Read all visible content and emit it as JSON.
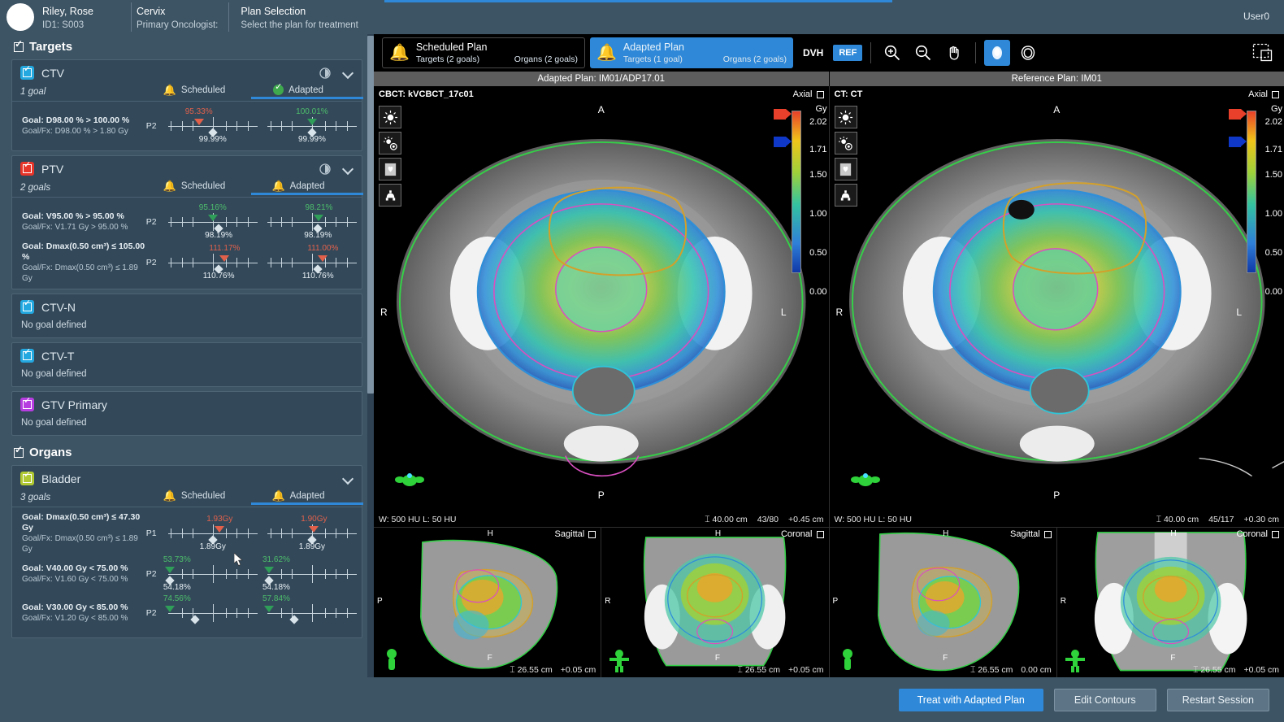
{
  "header": {
    "patient_name": "Riley, Rose",
    "patient_id": "ID1: S003",
    "site": "Cervix",
    "oncologist_label": "Primary Oncologist:",
    "task_title": "Plan Selection",
    "task_sub": "Select the plan for treatment",
    "user": "User0"
  },
  "targets": {
    "group_label": "Targets",
    "rois": [
      {
        "name": "CTV",
        "color": "#23a8e0",
        "goal_count": "1 goal",
        "scheduled_label": "Scheduled",
        "adapted_label": "Adapted",
        "scheduled_status": "bell",
        "adapted_status": "check",
        "goals": [
          {
            "goal": "Goal: D98.00 % > 100.00 %",
            "goal_fx": "Goal/Fx: D98.00 % > 1.80 Gy",
            "priority": "P2",
            "scheduled": {
              "value": "95.33%",
              "state": "bad",
              "pos": 36,
              "diamond": "99.99%",
              "diamond_pos": 50
            },
            "adapted": {
              "value": "100.01%",
              "state": "ok",
              "pos": 50,
              "diamond": "99.99%",
              "diamond_pos": 50
            }
          }
        ]
      },
      {
        "name": "PTV",
        "color": "#e8352a",
        "goal_count": "2 goals",
        "scheduled_label": "Scheduled",
        "adapted_label": "Adapted",
        "scheduled_status": "bell",
        "adapted_status": "bell",
        "goals": [
          {
            "goal": "Goal: V95.00 % > 95.00 %",
            "goal_fx": "Goal/Fx: V1.71 Gy > 95.00 %",
            "priority": "P2",
            "scheduled": {
              "value": "95.16%",
              "state": "ok",
              "pos": 50,
              "diamond": "98.19%",
              "diamond_pos": 56
            },
            "adapted": {
              "value": "98.21%",
              "state": "ok",
              "pos": 57,
              "diamond": "98.19%",
              "diamond_pos": 56
            }
          },
          {
            "goal": "Goal: Dmax(0.50 cm³) ≤ 105.00 %",
            "goal_fx": "Goal/Fx: Dmax(0.50 cm³) ≤ 1.89 Gy",
            "priority": "P2",
            "scheduled": {
              "value": "111.17%",
              "state": "bad",
              "pos": 62,
              "diamond": "110.76%",
              "diamond_pos": 56
            },
            "adapted": {
              "value": "111.00%",
              "state": "bad",
              "pos": 61,
              "diamond": "110.76%",
              "diamond_pos": 56
            }
          }
        ]
      },
      {
        "name": "CTV-N",
        "color": "#23a8e0",
        "no_goal": "No goal defined"
      },
      {
        "name": "CTV-T",
        "color": "#23a8e0",
        "no_goal": "No goal defined"
      },
      {
        "name": "GTV Primary",
        "color": "#b63ee0",
        "no_goal": "No goal defined"
      }
    ]
  },
  "organs": {
    "group_label": "Organs",
    "rois": [
      {
        "name": "Bladder",
        "color": "#b0c832",
        "goal_count": "3 goals",
        "scheduled_label": "Scheduled",
        "adapted_label": "Adapted",
        "scheduled_status": "bell",
        "adapted_status": "bell",
        "goals": [
          {
            "goal": "Goal: Dmax(0.50 cm³) ≤ 47.30 Gy",
            "goal_fx": "Goal/Fx: Dmax(0.50 cm³) ≤ 1.89 Gy",
            "priority": "P1",
            "scheduled": {
              "value": "1.93Gy",
              "state": "bad",
              "pos": 57,
              "diamond": "1.89Gy",
              "diamond_pos": 50
            },
            "adapted": {
              "value": "1.90Gy",
              "state": "bad",
              "pos": 52,
              "diamond": "1.89Gy",
              "diamond_pos": 50
            }
          },
          {
            "goal": "Goal: V40.00 Gy < 75.00 %",
            "goal_fx": "Goal/Fx: V1.60 Gy < 75.00 %",
            "priority": "P2",
            "scheduled": {
              "value": "53.73%",
              "state": "ok",
              "pos": 7,
              "diamond": "54.18%",
              "diamond_pos": 7
            },
            "adapted": {
              "value": "31.62%",
              "state": "ok",
              "pos": 7,
              "diamond": "54.18%",
              "diamond_pos": 7
            }
          },
          {
            "goal": "Goal: V30.00 Gy < 85.00 %",
            "goal_fx": "Goal/Fx: V1.20 Gy < 85.00 %",
            "priority": "P2",
            "scheduled": {
              "value": "74.56%",
              "state": "ok",
              "pos": 7,
              "diamond": "",
              "diamond_pos": 32
            },
            "adapted": {
              "value": "57.84%",
              "state": "ok",
              "pos": 7,
              "diamond": "",
              "diamond_pos": 32
            }
          }
        ]
      }
    ]
  },
  "toolbar": {
    "scheduled_plan": {
      "title": "Scheduled Plan",
      "targets": "Targets (2 goals)",
      "organs": "Organs (2 goals)"
    },
    "adapted_plan": {
      "title": "Adapted Plan",
      "targets": "Targets (1 goal)",
      "organs": "Organs (2 goals)"
    },
    "dvh_label": "DVH",
    "ref_label": "REF",
    "zoom_in": "zoom-in",
    "zoom_out": "zoom-out",
    "pan": "pan",
    "dose": "dose",
    "contour": "contour",
    "layout": "layout"
  },
  "viewer": {
    "left": {
      "plan_title": "Adapted Plan: IM01/ADP17.01",
      "series": "CBCT: kVCBCT_17c01",
      "orientation": "Axial",
      "window": "W: 500 HU   L: 50 HU",
      "fov": "40.00 cm",
      "slice": "43/80",
      "offset": "+0.45 cm",
      "colorbar": {
        "unit": "Gy",
        "ticks": [
          "2.02",
          "1.71",
          "1.50",
          "1.00",
          "0.50",
          "0.00"
        ]
      },
      "sagittal": {
        "label": "Sagittal",
        "fov": "26.55 cm",
        "offset": "+0.05 cm"
      },
      "coronal": {
        "label": "Coronal",
        "fov": "26.55 cm",
        "offset": "+0.05 cm"
      }
    },
    "right": {
      "plan_title": "Reference Plan: IM01",
      "series": "CT: CT",
      "orientation": "Axial",
      "window": "W: 500 HU   L: 50 HU",
      "fov": "40.00 cm",
      "slice": "45/117",
      "offset": "+0.30 cm",
      "colorbar": {
        "unit": "Gy",
        "ticks": [
          "2.02",
          "1.71",
          "1.50",
          "1.00",
          "0.50",
          "0.00"
        ]
      },
      "sagittal": {
        "label": "Sagittal",
        "fov": "26.55 cm",
        "offset": "0.00 cm"
      },
      "coronal": {
        "label": "Coronal",
        "fov": "26.55 cm",
        "offset": "+0.05 cm"
      }
    },
    "orient_letters": {
      "a": "A",
      "p": "P",
      "r": "R",
      "l": "L",
      "h": "H",
      "f": "F"
    }
  },
  "footer": {
    "treat": "Treat with Adapted Plan",
    "edit": "Edit Contours",
    "restart": "Restart Session"
  },
  "colors": {
    "accent": "#2f89d8",
    "warn": "#f0a81e",
    "ok": "#3faa4d",
    "bad": "#e2604a"
  }
}
